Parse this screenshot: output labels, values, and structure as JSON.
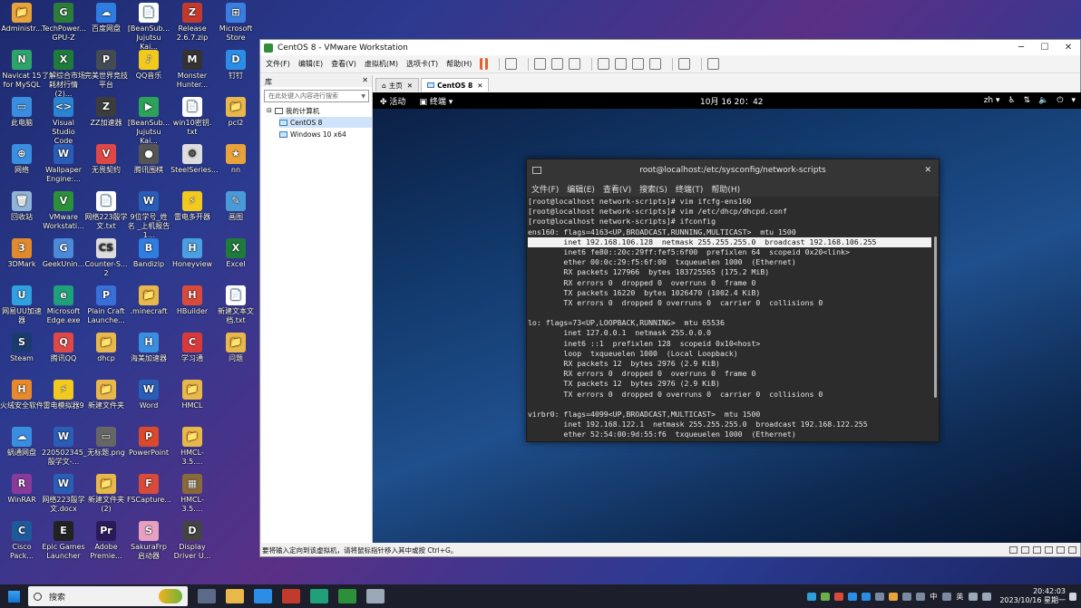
{
  "desktop_icons": [
    {
      "label": "Administr...",
      "color": "#e8a33a",
      "glyph": "📁"
    },
    {
      "label": "TechPower... GPU-Z",
      "color": "#2c7d3a",
      "glyph": "G"
    },
    {
      "label": "百度网盘",
      "color": "#2f7de1",
      "glyph": "☁"
    },
    {
      "label": "[BeanSub... Jujutsu Kai...",
      "color": "#ffffff",
      "glyph": "📄"
    },
    {
      "label": "Release 2.6.7.zip",
      "color": "#c23a2d",
      "glyph": "Z"
    },
    {
      "label": "Microsoft Store",
      "color": "#3a7ee0",
      "glyph": "⊞"
    },
    {
      "label": "Navicat 15 for MySQL",
      "color": "#2fa46a",
      "glyph": "N"
    },
    {
      "label": "了解综合市场 耗材行情(2)...",
      "color": "#1e7b3c",
      "glyph": "X"
    },
    {
      "label": "完美世界竞技 平台",
      "color": "#444b55",
      "glyph": "P"
    },
    {
      "label": "QQ音乐",
      "color": "#f2c91e",
      "glyph": "♪"
    },
    {
      "label": "Monster Hunter...",
      "color": "#333333",
      "glyph": "M"
    },
    {
      "label": "钉钉",
      "color": "#2b8de6",
      "glyph": "D"
    },
    {
      "label": "此电脑",
      "color": "#3a8ee0",
      "glyph": "▭"
    },
    {
      "label": "Visual Studio Code",
      "color": "#2a84d2",
      "glyph": "<>"
    },
    {
      "label": "ZZ加速器",
      "color": "#3c3c3c",
      "glyph": "Z"
    },
    {
      "label": "[BeanSub... Jujutsu Kai...",
      "color": "#2da15a",
      "glyph": "▶"
    },
    {
      "label": "win10密钥. txt",
      "color": "#ffffff",
      "glyph": "📄"
    },
    {
      "label": "pcl2",
      "color": "#e8b84a",
      "glyph": "📁"
    },
    {
      "label": "网络",
      "color": "#3a8ee0",
      "glyph": "⊕"
    },
    {
      "label": "Wallpaper Engine:...",
      "color": "#2a5db5",
      "glyph": "W"
    },
    {
      "label": "无畏契约",
      "color": "#e04848",
      "glyph": "V"
    },
    {
      "label": "腾讯围棋",
      "color": "#555555",
      "glyph": "●"
    },
    {
      "label": "SteelSeries...",
      "color": "#dddddd",
      "glyph": "⚙"
    },
    {
      "label": "nn",
      "color": "#e8a33a",
      "glyph": "★"
    },
    {
      "label": "回收站",
      "color": "#8fb4d8",
      "glyph": "🗑"
    },
    {
      "label": "VMware Workstati...",
      "color": "#2c8f3a",
      "glyph": "V"
    },
    {
      "label": "网络223殷学 文.txt",
      "color": "#ffffff",
      "glyph": "📄"
    },
    {
      "label": "9位学号_姓名 _上机报告1...",
      "color": "#2a5db5",
      "glyph": "W"
    },
    {
      "label": "雷电多开器",
      "color": "#f2c91e",
      "glyph": "⚡"
    },
    {
      "label": "画图",
      "color": "#4a9ad8",
      "glyph": "✎"
    },
    {
      "label": "3DMark",
      "color": "#e08a2b",
      "glyph": "3"
    },
    {
      "label": "GeekUnin...",
      "color": "#4a8ad8",
      "glyph": "G"
    },
    {
      "label": "Counter-S... 2",
      "color": "#dddddd",
      "glyph": "CS"
    },
    {
      "label": "Bandizip",
      "color": "#2f7de1",
      "glyph": "B"
    },
    {
      "label": "Honeyview",
      "color": "#4aa0e0",
      "glyph": "H"
    },
    {
      "label": "Excel",
      "color": "#1e7b3c",
      "glyph": "X"
    },
    {
      "label": "网易UU加速 器",
      "color": "#2fa0e0",
      "glyph": "U"
    },
    {
      "label": "Microsoft Edge.exe",
      "color": "#1fa07a",
      "glyph": "e"
    },
    {
      "label": "Plain Craft Launche...",
      "color": "#3a6ed8",
      "glyph": "P"
    },
    {
      "label": ".minecraft",
      "color": "#e8b84a",
      "glyph": "📁"
    },
    {
      "label": "HBuilder",
      "color": "#d84a3a",
      "glyph": "H"
    },
    {
      "label": "新建文本文 档.txt",
      "color": "#ffffff",
      "glyph": "📄"
    },
    {
      "label": "Steam",
      "color": "#1b3a6e",
      "glyph": "S"
    },
    {
      "label": "腾讯QQ",
      "color": "#e04848",
      "glyph": "Q"
    },
    {
      "label": "dhcp",
      "color": "#e8b84a",
      "glyph": "📁"
    },
    {
      "label": "海美加速器",
      "color": "#3a8ee0",
      "glyph": "H"
    },
    {
      "label": "学习通",
      "color": "#d83a3a",
      "glyph": "C"
    },
    {
      "label": "问题",
      "color": "#e8b84a",
      "glyph": "📁"
    },
    {
      "label": "火绒安全软件",
      "color": "#e88a2b",
      "glyph": "H"
    },
    {
      "label": "雷电模拟器9",
      "color": "#f2c91e",
      "glyph": "⚡"
    },
    {
      "label": "新建文件夹",
      "color": "#e8b84a",
      "glyph": "📁"
    },
    {
      "label": "Word",
      "color": "#2a5db5",
      "glyph": "W"
    },
    {
      "label": "HMCL",
      "color": "#e8b84a",
      "glyph": "📁"
    },
    {
      "label": "",
      "color": "transparent",
      "glyph": ""
    },
    {
      "label": "蜗通网盘",
      "color": "#3a8ee0",
      "glyph": "☁"
    },
    {
      "label": "220502345_ 殷学文-...",
      "color": "#2a5db5",
      "glyph": "W"
    },
    {
      "label": "无标题.png",
      "color": "#666666",
      "glyph": "▭"
    },
    {
      "label": "PowerPoint",
      "color": "#d84a2b",
      "glyph": "P"
    },
    {
      "label": "HMCL-3.5....",
      "color": "#e8b84a",
      "glyph": "📁"
    },
    {
      "label": "",
      "color": "transparent",
      "glyph": ""
    },
    {
      "label": "WinRAR",
      "color": "#8a3a9a",
      "glyph": "R"
    },
    {
      "label": "网络223殷学 文.docx",
      "color": "#2a5db5",
      "glyph": "W"
    },
    {
      "label": "新建文件夹 (2)",
      "color": "#e8b84a",
      "glyph": "📁"
    },
    {
      "label": "FSCapture...",
      "color": "#d84a3a",
      "glyph": "F"
    },
    {
      "label": "HMCL-3.5....",
      "color": "#8a6a3a",
      "glyph": "▦"
    },
    {
      "label": "",
      "color": "transparent",
      "glyph": ""
    },
    {
      "label": "Cisco Pack...",
      "color": "#1e5a9a",
      "glyph": "C"
    },
    {
      "label": "Epic Games Launcher",
      "color": "#222222",
      "glyph": "E"
    },
    {
      "label": "Adobe Premie...",
      "color": "#2a1a5a",
      "glyph": "Pr"
    },
    {
      "label": "SakuraFrp 启动器",
      "color": "#e8a0c0",
      "glyph": "S"
    },
    {
      "label": "Display Driver U...",
      "color": "#444444",
      "glyph": "D"
    }
  ],
  "vmware": {
    "title": "CentOS 8 - VMware Workstation",
    "menu": [
      "文件(F)",
      "编辑(E)",
      "查看(V)",
      "虚拟机(M)",
      "选项卡(T)",
      "帮助(H)"
    ],
    "library": {
      "header": "库",
      "search_placeholder": "在此处键入内容进行搜索",
      "root": "我的计算机",
      "vms": [
        "CentOS 8",
        "Windows 10 x64"
      ]
    },
    "tabs": [
      "主页",
      "CentOS 8"
    ],
    "status": "要将输入定向到该虚拟机，请将鼠标指针移入其中或按 Ctrl+G。"
  },
  "guest": {
    "activities": "活动",
    "terminal_menu": "终端 ▾",
    "clock": "10月 16 20：42",
    "lang": "zh ▾",
    "term_title": "root@localhost:/etc/sysconfig/network-scripts",
    "term_menu": [
      "文件(F)",
      "编辑(E)",
      "查看(V)",
      "搜索(S)",
      "终端(T)",
      "帮助(H)"
    ],
    "lines": [
      "[root@localhost network-scripts]# vim ifcfg-ens160",
      "[root@localhost network-scripts]# vim /etc/dhcp/dhcpd.conf",
      "[root@localhost network-scripts]# ifconfig",
      "ens160: flags=4163<UP,BROADCAST,RUNNING,MULTICAST>  mtu 1500",
      "        inet 192.168.106.128  netmask 255.255.255.0  broadcast 192.168.106.255",
      "        inet6 fe80::20c:29ff:fef5:6f00  prefixlen 64  scopeid 0x20<link>",
      "        ether 00:0c:29:f5:6f:00  txqueuelen 1000  (Ethernet)",
      "        RX packets 127966  bytes 183725565 (175.2 MiB)",
      "        RX errors 0  dropped 0  overruns 0  frame 0",
      "        TX packets 16220  bytes 1026470 (1002.4 KiB)",
      "        TX errors 0  dropped 0 overruns 0  carrier 0  collisions 0",
      "",
      "lo: flags=73<UP,LOOPBACK,RUNNING>  mtu 65536",
      "        inet 127.0.0.1  netmask 255.0.0.0",
      "        inet6 ::1  prefixlen 128  scopeid 0x10<host>",
      "        loop  txqueuelen 1000  (Local Loopback)",
      "        RX packets 12  bytes 2976 (2.9 KiB)",
      "        RX errors 0  dropped 0  overruns 0  frame 0",
      "        TX packets 12  bytes 2976 (2.9 KiB)",
      "        TX errors 0  dropped 0 overruns 0  carrier 0  collisions 0",
      "",
      "virbr0: flags=4099<UP,BROADCAST,MULTICAST>  mtu 1500",
      "        inet 192.168.122.1  netmask 255.255.255.0  broadcast 192.168.122.255",
      "        ether 52:54:00:9d:55:f6  txqueuelen 1000  (Ethernet)"
    ],
    "highlight_line": 4
  },
  "taskbar": {
    "search": "搜索",
    "tray_lang": "中",
    "tray_input": "英",
    "time": "20:42:03",
    "date": "2023/10/16 星期一"
  }
}
